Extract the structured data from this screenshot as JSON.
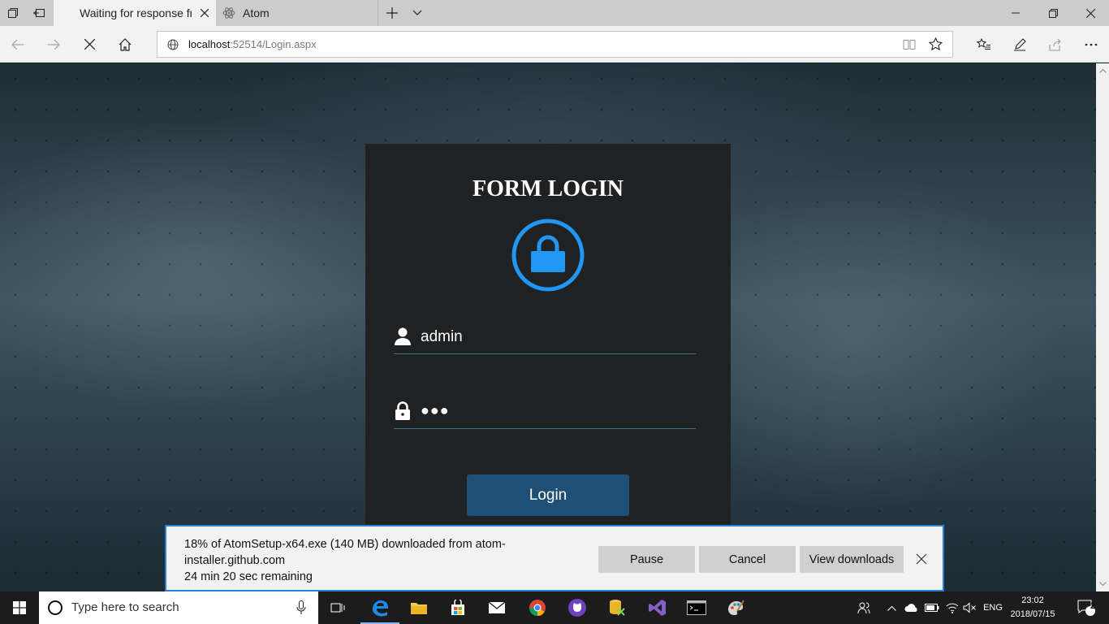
{
  "browser": {
    "tabs": [
      {
        "title": "Waiting for response fro",
        "icon": "loading"
      },
      {
        "title": "Atom",
        "icon": "atom-icon"
      }
    ],
    "address": {
      "host": "localhost",
      "rest": ":52514/Login.aspx"
    }
  },
  "login": {
    "title": "FORM LOGIN",
    "username": "admin",
    "password_mask": "●●●",
    "button": "Login"
  },
  "download": {
    "line1": "18% of AtomSetup-x64.exe (140 MB) downloaded from atom-",
    "line2": "installer.github.com",
    "line3": "24 min 20 sec remaining",
    "progress": 0.18,
    "pause": "Pause",
    "cancel": "Cancel",
    "view": "View downloads"
  },
  "taskbar": {
    "search_placeholder": "Type here to search",
    "language": "ENG",
    "time": "23:02",
    "date": "2018/07/15",
    "notifications": "2"
  },
  "colors": {
    "accent": "#2196f3",
    "button": "#1f4f75",
    "card": "#1f2122",
    "focus": "#2a7fd4"
  }
}
